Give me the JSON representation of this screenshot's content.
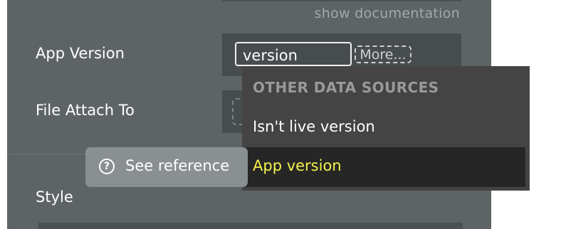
{
  "header": {
    "show_documentation": "show documentation"
  },
  "rows": {
    "app_version_label": "App Version",
    "file_attach_label": "File Attach To",
    "style_label": "Style"
  },
  "app_version_input": {
    "value": "version",
    "more_label": "More..."
  },
  "dropdown": {
    "section_header": "OTHER DATA SOURCES",
    "items": [
      {
        "label": "Isn't live version"
      },
      {
        "label": "App version",
        "selected": true
      }
    ]
  },
  "tooltip": {
    "label": "See reference",
    "icon": "question-circle-icon"
  },
  "colors": {
    "panel": "#5e6466",
    "field": "#474c4e",
    "dropdown": "#444444",
    "selected_item_bg": "#262626",
    "selected_item_text": "#f4f24b",
    "tooltip_bg": "#8a8f91"
  }
}
